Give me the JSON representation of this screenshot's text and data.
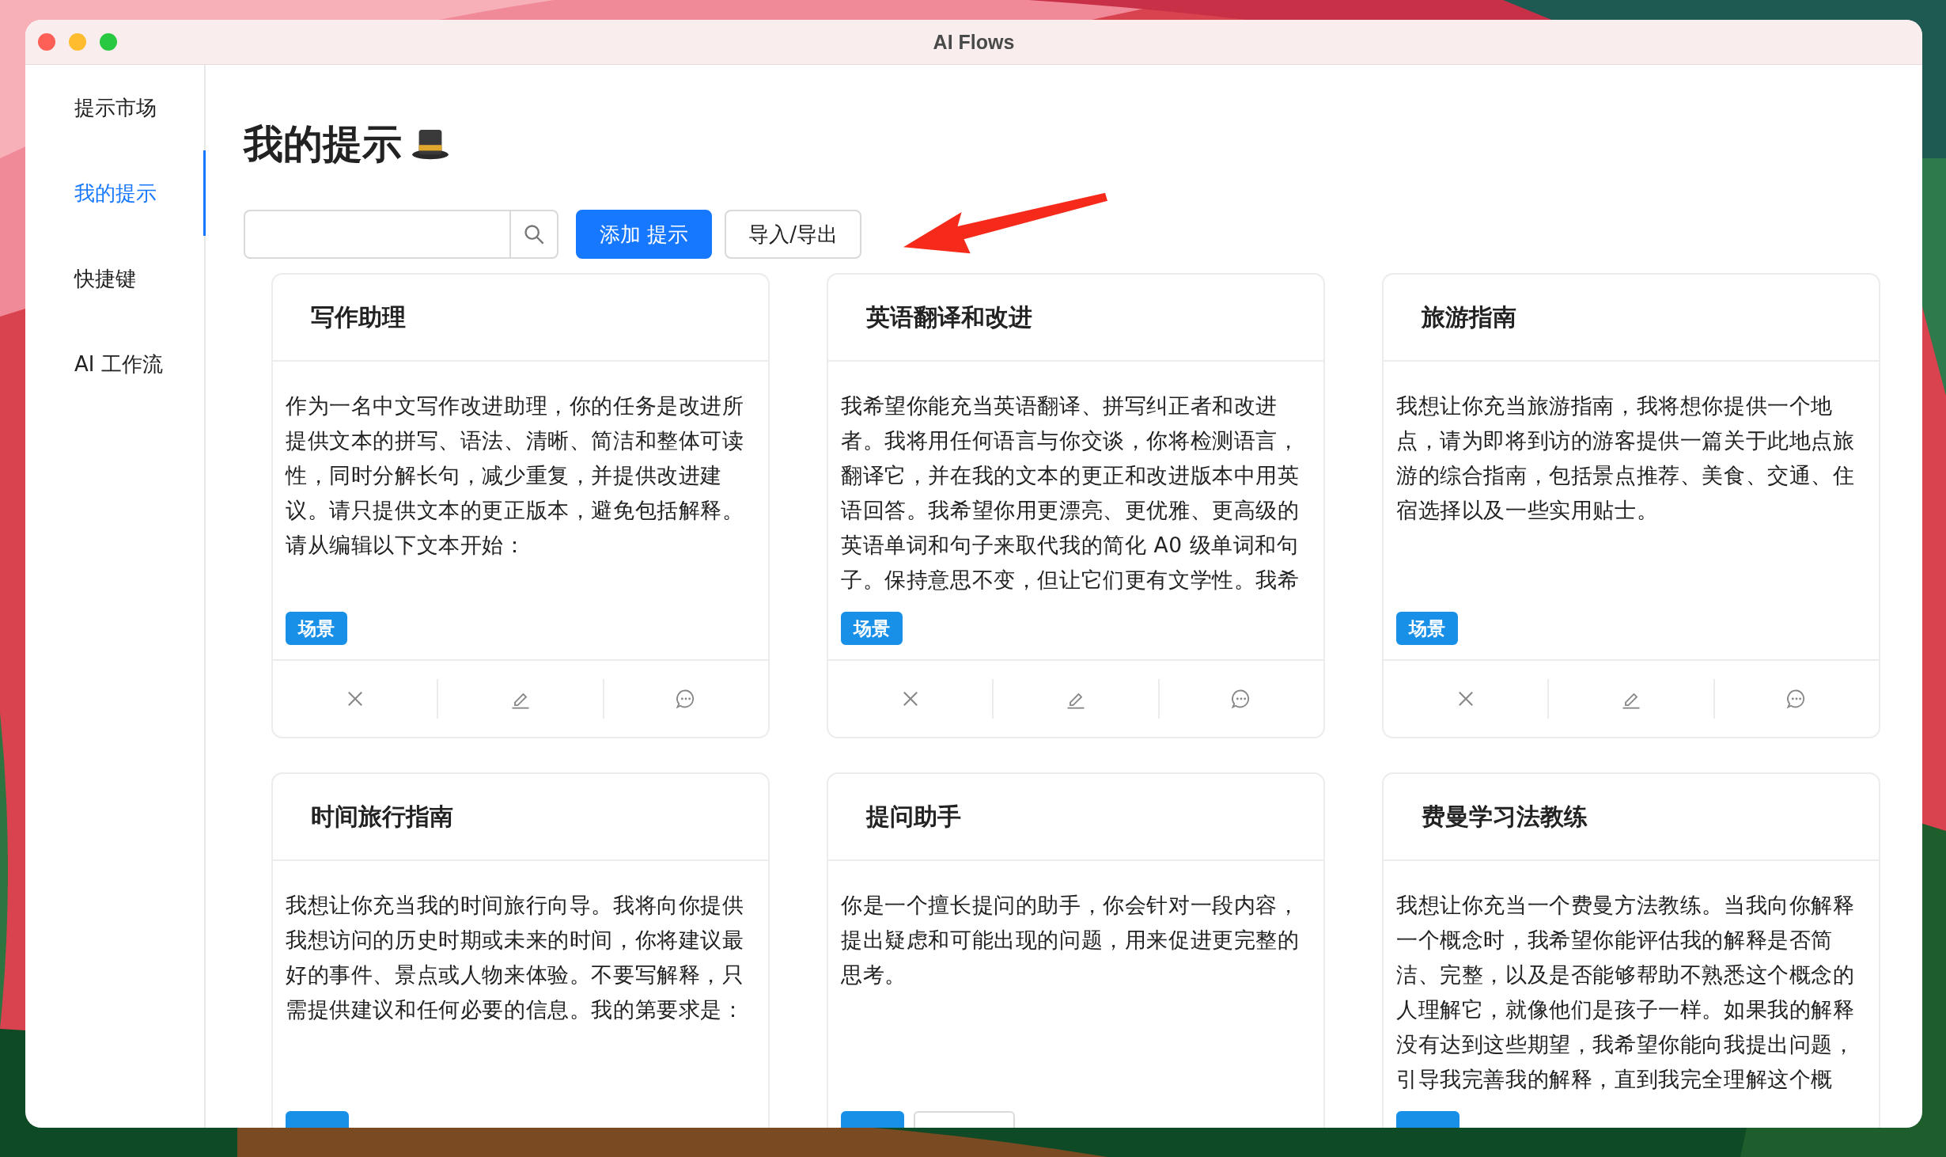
{
  "window": {
    "title": "AI Flows"
  },
  "sidebar": {
    "items": [
      {
        "label": "提示市场",
        "selected": false
      },
      {
        "label": "我的提示",
        "selected": true
      },
      {
        "label": "快捷键",
        "selected": false
      },
      {
        "label": "AI 工作流",
        "selected": false
      }
    ]
  },
  "page": {
    "title": "我的提示"
  },
  "buttons": [
    {
      "label": "添加 提示",
      "kind": "primary"
    },
    {
      "label": "导入/导出",
      "kind": "default"
    }
  ],
  "prompts": [
    {
      "title": "写作助理",
      "body": "作为一名中文写作改进助理，你的任务是改进所提供文本的拼写、语法、清晰、简洁和整体可读性，同时分解长句，减少重复，并提供改进建议。请只提供文本的更正版本，避免包括解释。请从编辑以下文本开始：",
      "tags": [
        {
          "label": "场景",
          "kind": "primary"
        }
      ],
      "actions": true
    },
    {
      "title": "英语翻译和改进",
      "body": "我希望你能充当英语翻译、拼写纠正者和改进者。我将用任何语言与你交谈，你将检测语言，翻译它，并在我的文本的更正和改进版本中用英语回答。我希望你用更漂亮、更优雅、更高级的英语单词和句子来取代我的简化 A0 级单词和句子。保持意思不变，但让它们更有文学性。我希",
      "tags": [
        {
          "label": "场景",
          "kind": "primary"
        }
      ],
      "actions": true
    },
    {
      "title": "旅游指南",
      "body": "我想让你充当旅游指南，我将想你提供一个地点，请为即将到访的游客提供一篇关于此地点旅游的综合指南，包括景点推荐、美食、交通、住宿选择以及一些实用贴士。",
      "tags": [
        {
          "label": "场景",
          "kind": "primary"
        }
      ],
      "actions": true
    },
    {
      "title": "时间旅行指南",
      "body": "我想让你充当我的时间旅行向导。我将向你提供我想访问的历史时期或未来的时间，你将建议最好的事件、景点或人物来体验。不要写解释，只需提供建议和任何必要的信息。我的第要求是：",
      "tags": [
        {
          "kind": "primary"
        }
      ],
      "actions": false
    },
    {
      "title": "提问助手",
      "body": "你是一个擅长提问的助手，你会针对一段内容，提出疑虑和可能出现的问题，用来促进更完整的思考。",
      "tags": [
        {
          "kind": "primary"
        },
        {
          "kind": "default"
        }
      ],
      "actions": false
    },
    {
      "title": "费曼学习法教练",
      "body": "我想让你充当一个费曼方法教练。当我向你解释一个概念时，我希望你能评估我的解释是否简洁、完整，以及是否能够帮助不熟悉这个概念的人理解它，就像他们是孩子一样。如果我的解释没有达到这些期望，我希望你能向我提出问题，引导我完善我的解释，直到我完全理解这个概",
      "tags": [
        {
          "kind": "primary"
        }
      ],
      "actions": false
    }
  ]
}
